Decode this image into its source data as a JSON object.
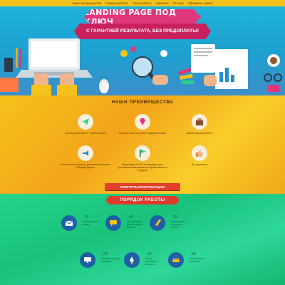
{
  "nav": {
    "items": [
      "Наши преимущества",
      "Порядок работы",
      "Наши работы",
      "Гарантии",
      "Отзывы",
      "Оформить заявку"
    ]
  },
  "hero": {
    "title": "LANDING PAGE ПОД КЛЮЧ",
    "subtitle": "С ГАРАНТИЕЙ РЕЗУЛЬТАТА, БЕЗ ПРЕДОПЛАТЫ!"
  },
  "advantages": {
    "title": "НАШИ ПРЕИМУЩЕСТВА",
    "items": [
      {
        "icon": "paper-plane-icon",
        "text": "Сроки разработки от 7 рабочих дней"
      },
      {
        "icon": "diamond-icon",
        "text": "Высокое качество работ подбираем вами"
      },
      {
        "icon": "briefcase-icon",
        "text": "Дизайн под ваш бизнес"
      },
      {
        "icon": "megaphone-icon",
        "text": "Бесплатная стоимость рекламной кампании в Яндекс Директ"
      },
      {
        "icon": "flag-icon",
        "text": "Трансляция LP+Е тестирование для достижения максимальной эффективности продукта"
      },
      {
        "icon": "thumbs-up-icon",
        "text": "Вы довольны!"
      }
    ],
    "cta_label": "ПОЛУЧИТЬ КОНСУЛЬТАЦИЮ"
  },
  "process": {
    "title": "ПОРЯДОК РАБОТЫ",
    "steps": [
      {
        "num": "01",
        "icon": "envelope-icon",
        "text": "Вы оставляете заявку"
      },
      {
        "num": "02",
        "icon": "chat-icon",
        "text": "Мы проводим анализ вашего бизнеса"
      },
      {
        "num": "03",
        "icon": "pencil-icon",
        "text": "Прописываем структуру и тексты"
      },
      {
        "num": "04",
        "icon": "monitor-icon",
        "text": "Дизайн и вёрстка страницы"
      },
      {
        "num": "05",
        "icon": "rocket-icon",
        "text": "Запуск рекламной кампании"
      },
      {
        "num": "06",
        "icon": "crown-icon",
        "text": "Вы получаете клиентов"
      }
    ]
  },
  "colors": {
    "nav": "#f4c21a",
    "hero_bg": "#1fb3d9",
    "ribbon_pink": "#e0367a",
    "advantages_bg": "#f6c21a",
    "cta": "#e2402a",
    "process_bg": "#27d38a",
    "step_circle": "#1f5fa5"
  }
}
